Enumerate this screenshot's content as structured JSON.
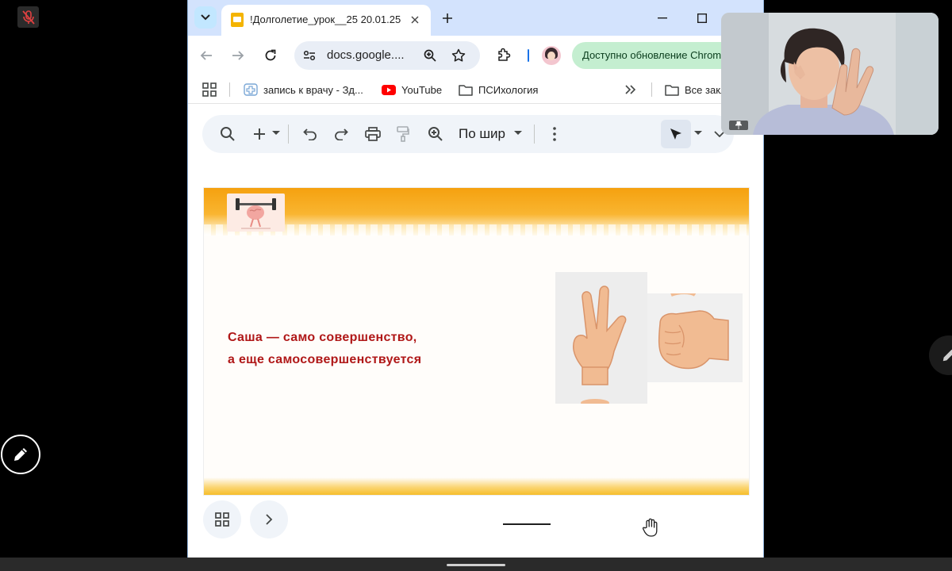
{
  "meeting": {
    "mic_icon": "muted-mic-icon",
    "pen_icon": "pencil-icon"
  },
  "browser": {
    "tab": {
      "title": "!Долголетие_урок__25 20.01.25",
      "favicon": "google-slides-icon"
    },
    "omnibox": {
      "url": "docs.google...."
    },
    "update_button": "Доступно обновление Chrome",
    "bookmarks": [
      {
        "label": "запись к врачу - Зд...",
        "icon": "health-icon"
      },
      {
        "label": "YouTube",
        "icon": "youtube-icon"
      },
      {
        "label": "ПСИхология",
        "icon": "folder-icon"
      },
      {
        "label": "Все закладки",
        "icon": "folder-icon"
      }
    ]
  },
  "viewer": {
    "zoom_label": "По шир",
    "slide": {
      "line1": "Саша — само совершенство,",
      "line2": "а еще самосовершенствуется",
      "images": [
        "brain-lifting-barbell-illustration",
        "hand-three-fingers-illustration",
        "hand-fist-illustration"
      ]
    }
  },
  "colors": {
    "slide_text": "#b01818",
    "slide_banner": "#f5a10f",
    "tabstrip": "#d3e3fd",
    "update_pill": "#c4eed0"
  }
}
